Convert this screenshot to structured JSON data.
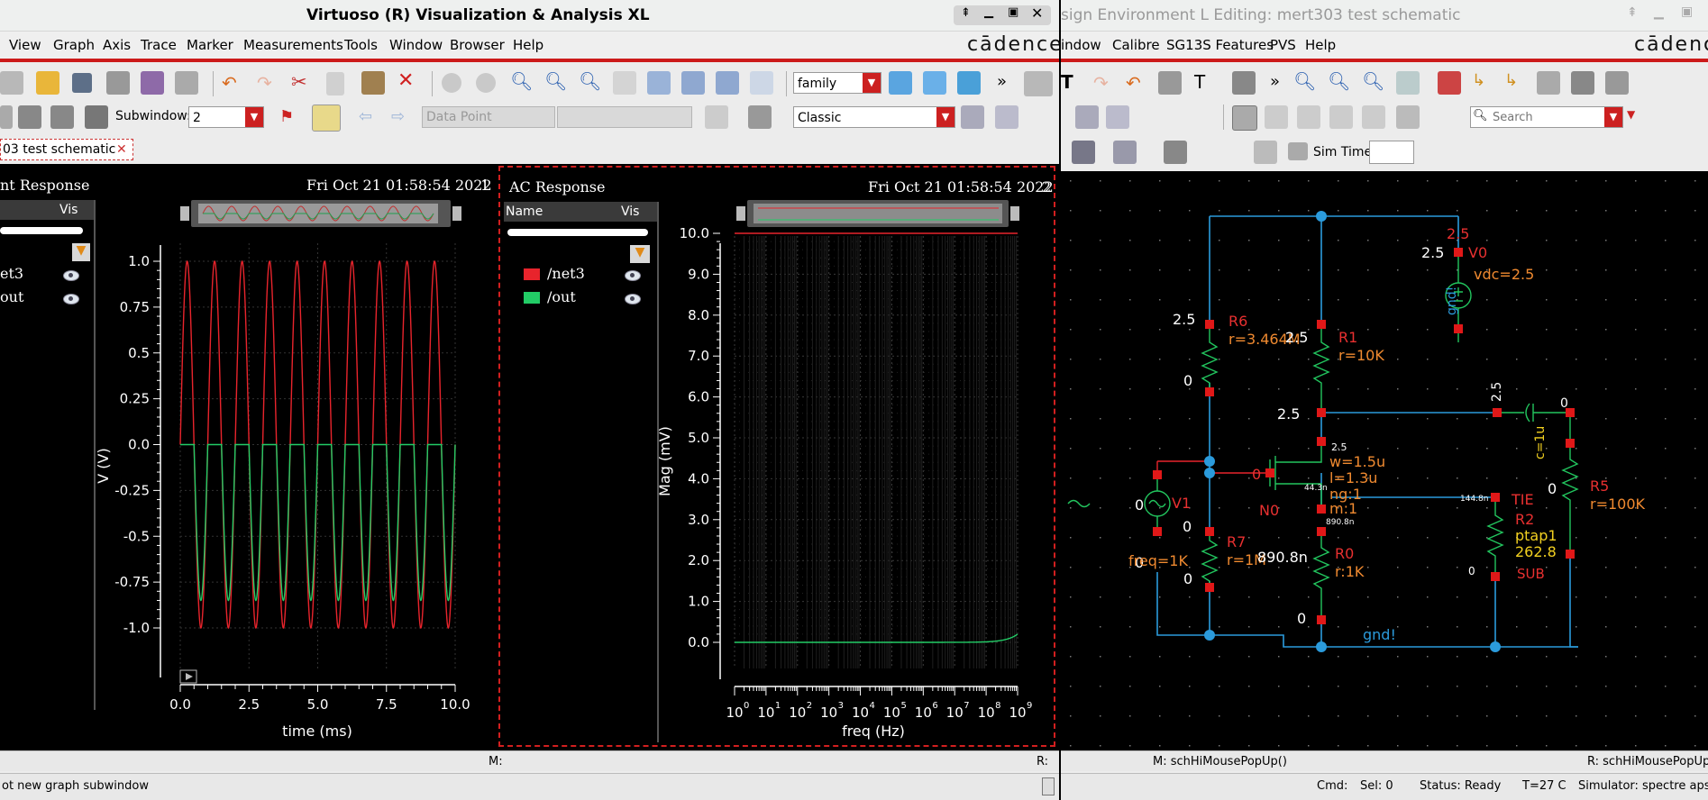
{
  "left_window": {
    "title": "Virtuoso (R) Visualization & Analysis XL",
    "menu": [
      "View",
      "Graph",
      "Axis",
      "Trace",
      "Marker",
      "Measurements",
      "Tools",
      "Window",
      "Browser",
      "Help"
    ],
    "brand": "cādence",
    "toolbar": {
      "family_combo": "family",
      "subwindow_label": "Subwindow:",
      "subwindow_value": "2",
      "datapoint_combo": "Data Point",
      "style_combo": "Classic"
    },
    "tab_label": "03 test schematic",
    "transient": {
      "title": "nt Response",
      "date": "Fri Oct 21 01:58:54 2022",
      "index": "1",
      "legend_col": "Vis",
      "legend_items": [
        "et3",
        "out"
      ],
      "ylabel": "V (V)",
      "xlabel": "time (ms)",
      "yticks": [
        "1.0",
        "0.75",
        "0.5",
        "0.25",
        "0.0",
        "-0.25",
        "-0.5",
        "-0.75",
        "-1.0"
      ],
      "xticks": [
        "0.0",
        "2.5",
        "5.0",
        "7.5",
        "10.0"
      ]
    },
    "ac": {
      "title": "AC Response",
      "date": "Fri Oct 21 01:58:54 2022",
      "index": "2",
      "legend_name_col": "Name",
      "legend_vis_col": "Vis",
      "legend_items": [
        "/net3",
        "/out"
      ],
      "ylabel": "Mag (mV)",
      "xlabel": "freq (Hz)",
      "yticks": [
        "10.0",
        "9.0",
        "8.0",
        "7.0",
        "6.0",
        "5.0",
        "4.0",
        "3.0",
        "2.0",
        "1.0",
        "0.0"
      ]
    },
    "status_marker": "M:",
    "status_right": "R:",
    "status_message": "ot new graph subwindow"
  },
  "right_window": {
    "title": "sign Environment L Editing: mert303 test schematic",
    "menu": [
      "indow",
      "Calibre",
      "SG13S Features",
      "PVS",
      "Help"
    ],
    "brand": "cādence",
    "search_placeholder": "Search",
    "sim_time_label": "Sim Time",
    "status_mouse_left": "M: schHiMousePopUp()",
    "status_mouse_right": "R: schHiMousePopUp",
    "status": {
      "cmd": "Cmd:",
      "sel": "Sel: 0",
      "state": "Status: Ready",
      "temp": "T=27 C",
      "sim": "Simulator: spectre aps"
    }
  },
  "schematic": {
    "labels": {
      "v0_top": "2.5",
      "v0_left": "2.5",
      "v0_name": "V0",
      "v0_param": "vdc=2.5",
      "gnd_small": "gnd!",
      "r6_top": "2.5",
      "r6_name": "R6",
      "r6_param": "r=3.464M",
      "r6_bot": "0",
      "r1_top": "2.5",
      "r1_name": "R1",
      "r1_param": "r=10K",
      "r1_bot": "2.5",
      "c_top": "2.5",
      "c_right": "0",
      "c_param": "c=1u",
      "m_d": "2.5",
      "m_w": "w=1.5u",
      "m_l": "l=1.3u",
      "m_ng": "ng:1",
      "m_m": "m:1",
      "m_name": "N0",
      "m_g": "0",
      "m_v1": "44.3n",
      "m_v2": "890.8n",
      "m_v3": "144.8n",
      "v1_name": "V1",
      "v1_top": "0",
      "v1_bot": "0",
      "v1_param": "freq=1K",
      "r7_top": "0",
      "r7_name": "R7",
      "r7_param": "r=1M",
      "r7_bot": "0",
      "r0_top": "890.8n",
      "r0_name": "R0",
      "r0_param": "r:1K",
      "r0_bot": "0",
      "r5_name": "R5",
      "r5_param": "r=100K",
      "r5_top": "0",
      "tie_name": "TIE",
      "r2_name": "R2",
      "ptap": "ptap1",
      "ptap_val": "262.8",
      "sub": "SUB",
      "r2_bot": "0",
      "gnd_main": "gnd!"
    }
  },
  "colors": {
    "net3": "#e8242c",
    "out": "#22cc66",
    "wire": "#2b9bdc",
    "pin": "#e01818",
    "comp": "#22c55e",
    "label_red": "#e83030",
    "label_orange": "#f08a30",
    "label_yellow": "#f2d020"
  }
}
